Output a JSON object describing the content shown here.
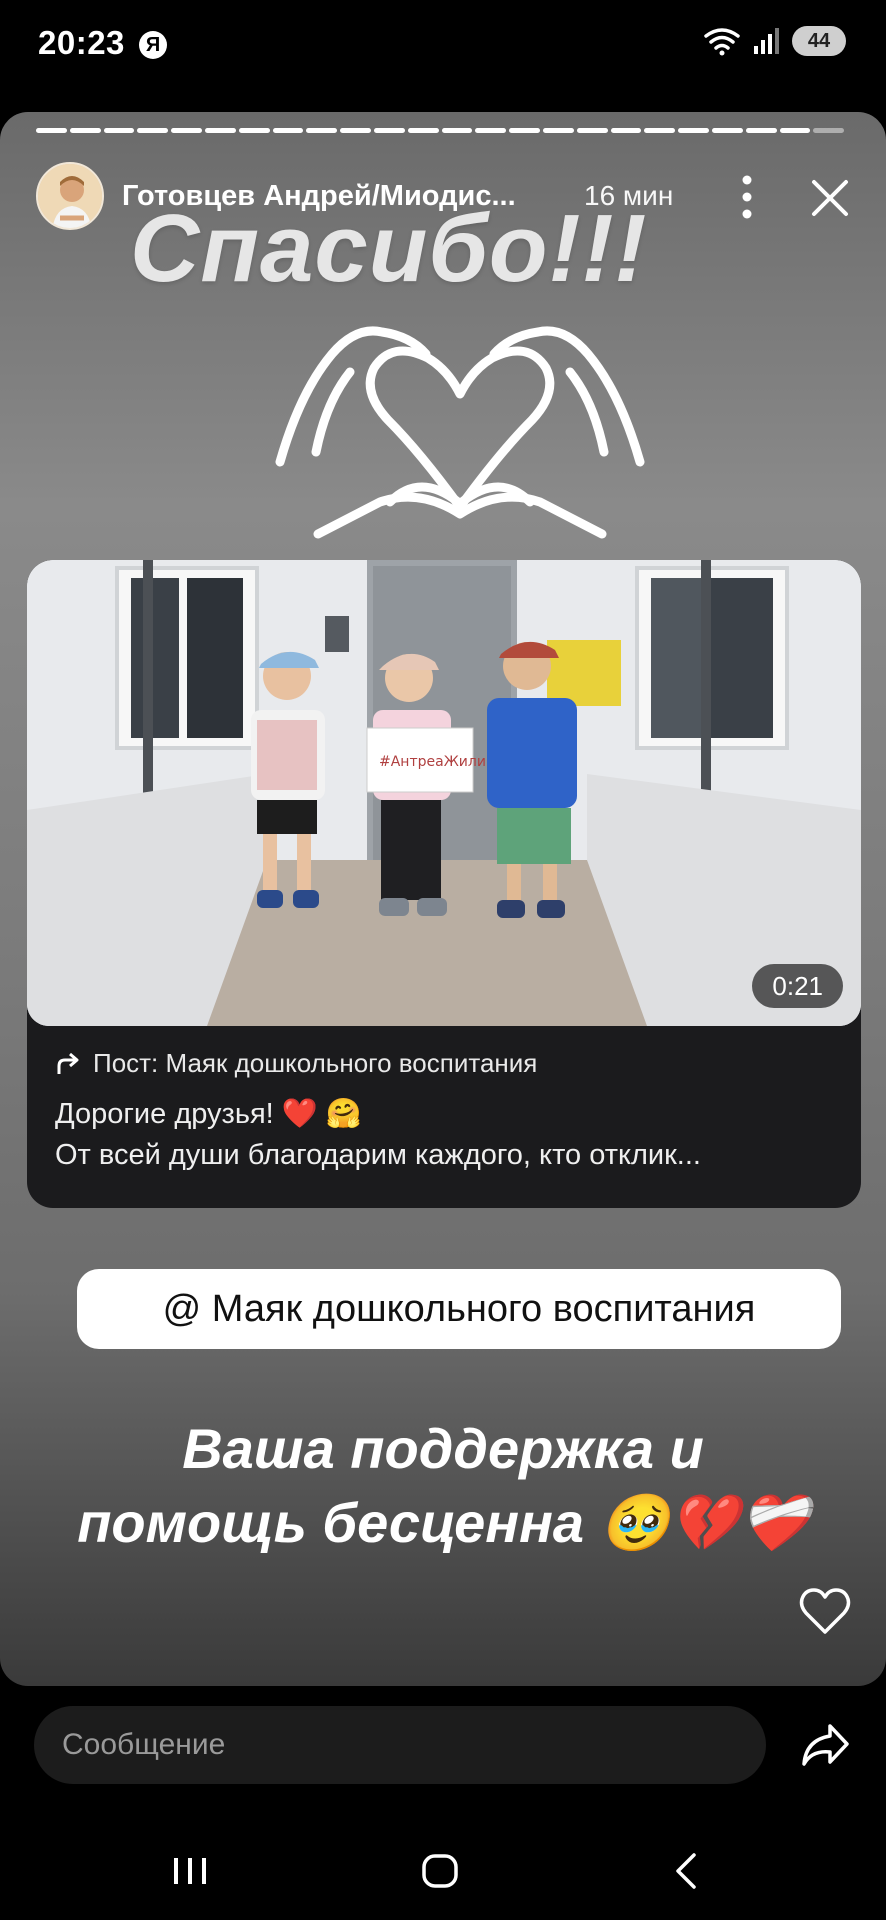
{
  "status_bar": {
    "time": "20:23",
    "app_badge": "Я",
    "battery": "44"
  },
  "story": {
    "author": "Готовцев Андрей/Миодис...",
    "time_ago": "16 мин",
    "progress_segments": 24,
    "big_title": "Спасибо!!!",
    "post": {
      "duration": "0:21",
      "source": "Пост: Маяк дошкольного воспитания",
      "text_line1": "Дорогие друзья! ❤️ 🤗",
      "text_line2": "От всей души благодарим каждого, кто отклик...",
      "sign_text": "#AнтреаЖилий"
    },
    "mention": "@ Маяк дошкольного воспитания",
    "support_line1": "Ваша поддержка и",
    "support_line2": "помощь бесценна 🥹💔❤️‍🩹"
  },
  "bottom": {
    "message_placeholder": "Сообщение"
  },
  "colors": {
    "card_bg": "#1b1b1d",
    "chip_bg": "#ffffff",
    "input_bg": "#1c1c1c"
  }
}
